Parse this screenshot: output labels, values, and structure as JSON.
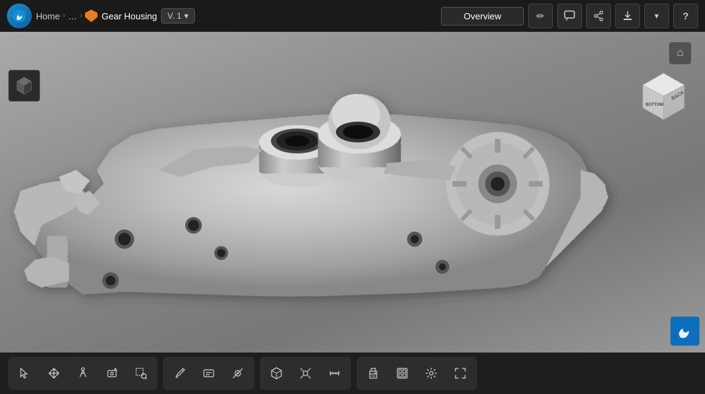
{
  "topbar": {
    "logo_alt": "Onshape Logo",
    "breadcrumb": {
      "home": "Home",
      "sep1": "›",
      "ellipsis": "…",
      "sep2": "›",
      "current": "Gear Housing"
    },
    "version": "V. 1",
    "version_dropdown_label": "▾",
    "overview_label": "Overview",
    "buttons": {
      "edit": "✏",
      "comment": "💬",
      "share": "⬆",
      "export": "⬇",
      "dropdown": "▾",
      "help": "?"
    }
  },
  "viewer": {
    "home_icon": "⌂",
    "cube_faces": {
      "back": "BACK",
      "bottom": "BOTTOM"
    }
  },
  "toolbar_groups": [
    {
      "id": "navigation",
      "tools": [
        {
          "id": "select",
          "icon": "↖",
          "label": "Select",
          "active": false
        },
        {
          "id": "pan",
          "icon": "✋",
          "label": "Pan",
          "active": false
        },
        {
          "id": "walk",
          "icon": "🚶",
          "label": "Walk",
          "active": false
        },
        {
          "id": "rotate-camera",
          "icon": "📷",
          "label": "Rotate Camera",
          "active": false
        },
        {
          "id": "zoom-window",
          "icon": "⊞",
          "label": "Zoom Window",
          "active": false
        }
      ]
    },
    {
      "id": "annotation",
      "tools": [
        {
          "id": "note",
          "icon": "✏",
          "label": "Note",
          "active": false
        },
        {
          "id": "text-note",
          "icon": "📝",
          "label": "Text Note",
          "active": false
        },
        {
          "id": "hide",
          "icon": "◉",
          "label": "Hide",
          "active": false
        }
      ]
    },
    {
      "id": "view",
      "tools": [
        {
          "id": "cube-view",
          "icon": "⬛",
          "label": "Cube View",
          "active": false
        },
        {
          "id": "explode",
          "icon": "⬡",
          "label": "Explode",
          "active": false
        },
        {
          "id": "measure",
          "icon": "📏",
          "label": "Measure",
          "active": false
        }
      ]
    },
    {
      "id": "render",
      "tools": [
        {
          "id": "print",
          "icon": "🖨",
          "label": "Print",
          "active": false
        },
        {
          "id": "view-settings",
          "icon": "▦",
          "label": "View Settings",
          "active": false
        },
        {
          "id": "settings",
          "icon": "⚙",
          "label": "Settings",
          "active": false
        },
        {
          "id": "fullscreen",
          "icon": "⊡",
          "label": "Fullscreen",
          "active": false
        }
      ]
    }
  ]
}
